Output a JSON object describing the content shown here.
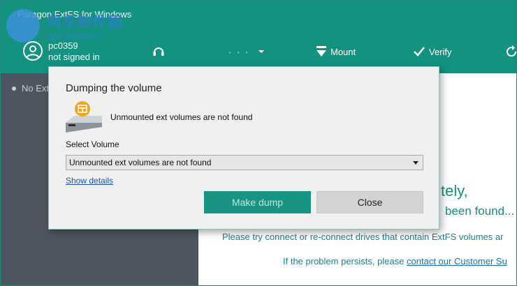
{
  "window": {
    "title": "Paragon ExtFS for Windows"
  },
  "watermark": {
    "text": "河东软件园",
    "sub": "www.pc0359.cn"
  },
  "user": {
    "name": "pc0359",
    "status": "not signed in"
  },
  "toolbar": {
    "support_icon": "headset-icon",
    "more_label": "· · ·",
    "mount_label": "Mount",
    "verify_label": "Verify"
  },
  "sidebar": {
    "items": [
      {
        "label": "No Ext"
      }
    ]
  },
  "main": {
    "title_fragment": "tely,",
    "sub_fragment": "been found...",
    "line1": "Please try connect or re-connect drives that contain ExtFS volumes ar",
    "line2_prefix": "If the problem persists, please ",
    "line2_link": "contact our Customer Su"
  },
  "dialog": {
    "title": "Dumping the volume",
    "status": "Unmounted ext volumes are not found",
    "select_label": "Select Volume",
    "select_value": "Unmounted ext volumes are not found",
    "show_details": "Show details",
    "make_dump": "Make dump",
    "close": "Close"
  },
  "colors": {
    "accent": "#12927f",
    "sidebar": "#4d5560",
    "link": "#1a56b8"
  }
}
